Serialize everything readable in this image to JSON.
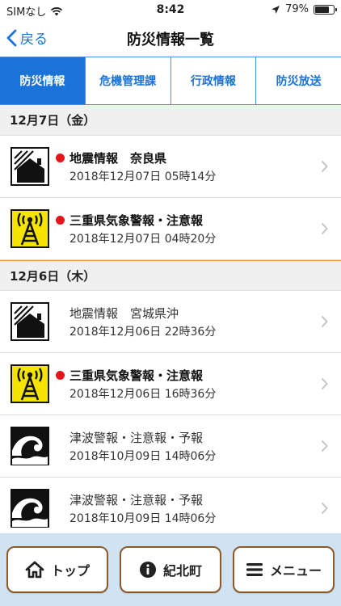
{
  "status_bar": {
    "carrier": "SIMなし",
    "time": "8:42",
    "battery_text": "79%",
    "battery_level": 0.79
  },
  "nav": {
    "back_label": "戻る",
    "title": "防災情報一覧"
  },
  "tabs": [
    {
      "label": "防災情報",
      "active": true
    },
    {
      "label": "危機管理課",
      "active": false
    },
    {
      "label": "行政情報",
      "active": false
    },
    {
      "label": "防災放送",
      "active": false
    }
  ],
  "sections": [
    {
      "header": "12月7日（金）",
      "items": [
        {
          "icon": "earthquake-icon",
          "unread": true,
          "title": "地震情報　奈良県",
          "date": "2018年12月07日 05時14分"
        },
        {
          "icon": "weather-warning-icon",
          "unread": true,
          "title": "三重県気象警報・注意報",
          "date": "2018年12月07日 04時20分"
        }
      ]
    },
    {
      "header": "12月6日（木）",
      "items": [
        {
          "icon": "earthquake-icon",
          "unread": false,
          "title": "地震情報　宮城県沖",
          "date": "2018年12月06日 22時36分"
        },
        {
          "icon": "weather-warning-icon",
          "unread": true,
          "title": "三重県気象警報・注意報",
          "date": "2018年12月06日 16時36分"
        },
        {
          "icon": "tsunami-icon",
          "unread": false,
          "title": "津波警報・注意報・予報",
          "date": "2018年10月09日 14時06分"
        },
        {
          "icon": "tsunami-icon",
          "unread": false,
          "title": "津波警報・注意報・予報",
          "date": "2018年10月09日 14時06分"
        }
      ]
    }
  ],
  "bottom_bar": {
    "top_label": "トップ",
    "town_label": "紀北町",
    "menu_label": "メニュー"
  },
  "colors": {
    "accent": "#1a73d9",
    "unread_dot": "#e8131b",
    "button_border": "#8a5a2b",
    "bottom_bg": "#cfe3f3",
    "warning_yellow": "#f5e400"
  }
}
